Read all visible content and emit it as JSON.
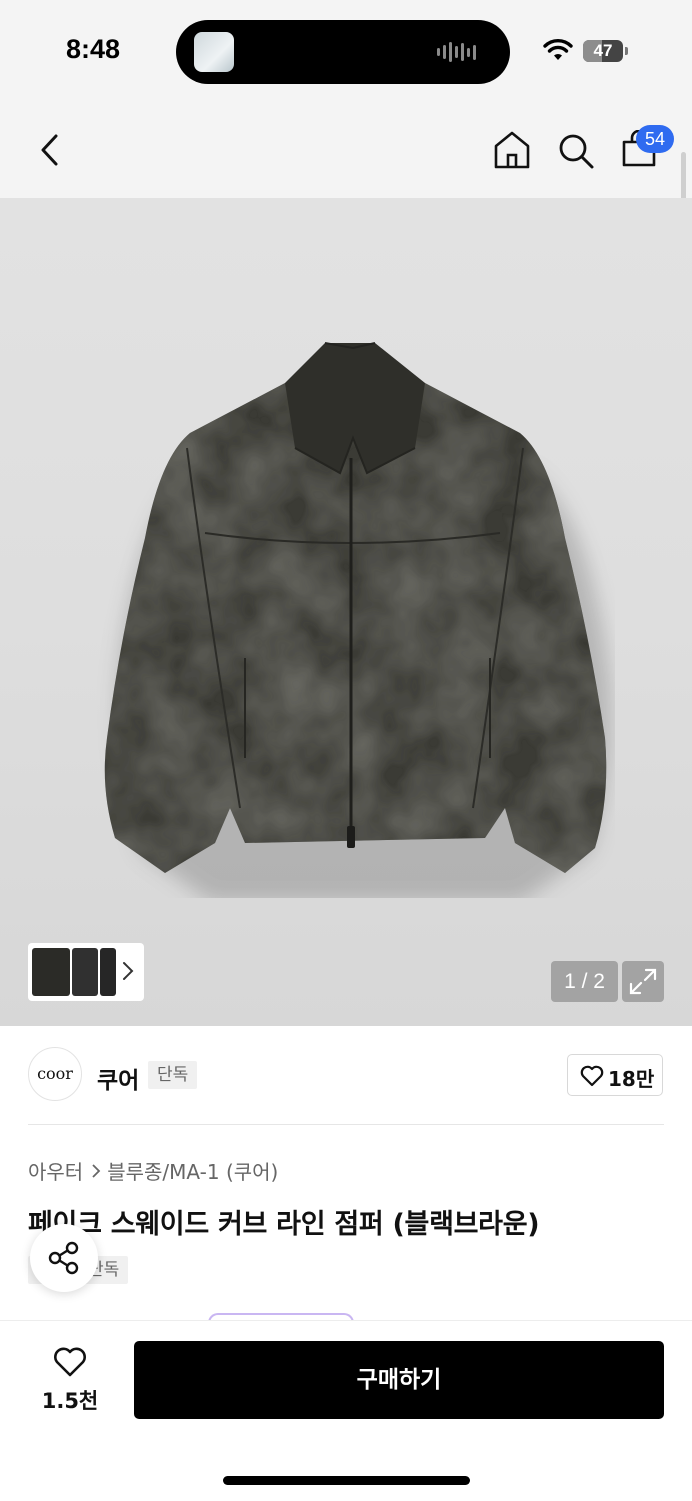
{
  "status_bar": {
    "time": "8:48",
    "battery": "47",
    "battery_level": 0.47
  },
  "header": {
    "back_icon": "chevron-left-icon",
    "home_icon": "home-icon",
    "search_icon": "search-icon",
    "cart_icon": "shopping-bag-icon",
    "cart_count": "54",
    "badge_color": "#2f6bf0"
  },
  "gallery": {
    "pager": "1 / 2",
    "expand_icon": "expand-icon",
    "thumb_chevron_icon": "chevron-right-icon"
  },
  "brand": {
    "logo_text": "coor",
    "name": "쿠어",
    "tag": "단독",
    "like_count": "18만"
  },
  "product": {
    "breadcrumb": [
      "아우터",
      "블루종/MA-1 (쿠어)"
    ],
    "title": "페이크 스웨이드 커브 라인 점퍼 (블랙브라운)",
    "tag": "단독"
  },
  "bottom_bar": {
    "like_count": "1.5천",
    "buy_label": "구매하기"
  }
}
